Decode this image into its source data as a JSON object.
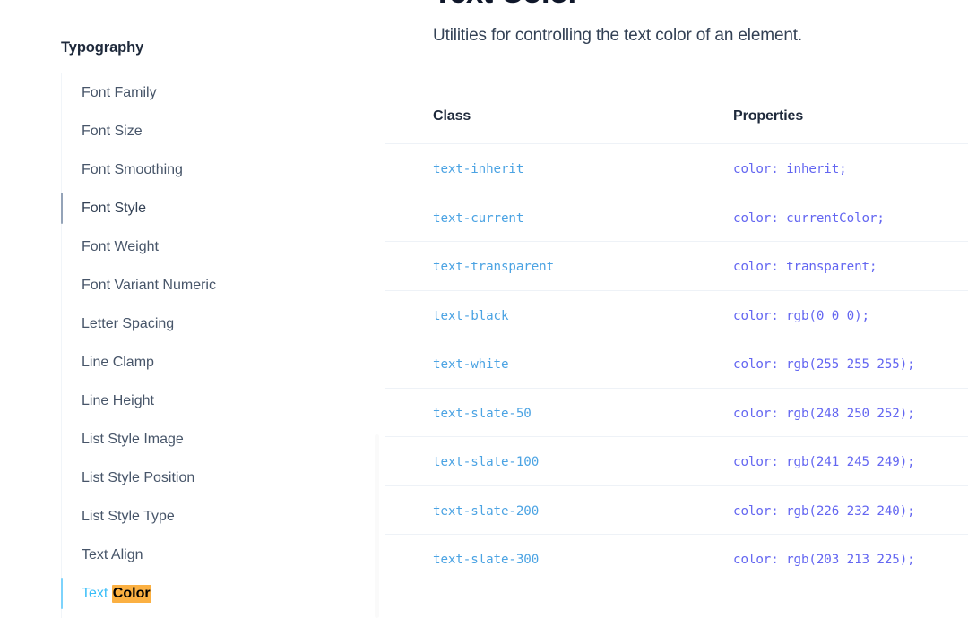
{
  "sidebar": {
    "group_title": "Typography",
    "items": [
      {
        "label": "Font Family",
        "state": "normal"
      },
      {
        "label": "Font Size",
        "state": "normal"
      },
      {
        "label": "Font Smoothing",
        "state": "normal"
      },
      {
        "label": "Font Style",
        "state": "hovered"
      },
      {
        "label": "Font Weight",
        "state": "normal"
      },
      {
        "label": "Font Variant Numeric",
        "state": "normal"
      },
      {
        "label": "Letter Spacing",
        "state": "normal"
      },
      {
        "label": "Line Clamp",
        "state": "normal"
      },
      {
        "label": "Line Height",
        "state": "normal"
      },
      {
        "label": "List Style Image",
        "state": "normal"
      },
      {
        "label": "List Style Position",
        "state": "normal"
      },
      {
        "label": "List Style Type",
        "state": "normal"
      },
      {
        "label": "Text Align",
        "state": "normal"
      },
      {
        "label": "Text Color",
        "state": "active",
        "plain": "Text ",
        "marked": "Color"
      }
    ],
    "active_label": "Text Color",
    "hovered_label": "Font Style"
  },
  "main": {
    "title": "Text Color",
    "subtitle": "Utilities for controlling the text color of an element.",
    "table": {
      "columns": [
        "Class",
        "Properties"
      ],
      "rows": [
        {
          "class": "text-inherit",
          "properties": "color: inherit;"
        },
        {
          "class": "text-current",
          "properties": "color: currentColor;"
        },
        {
          "class": "text-transparent",
          "properties": "color: transparent;"
        },
        {
          "class": "text-black",
          "properties": "color: rgb(0 0 0);"
        },
        {
          "class": "text-white",
          "properties": "color: rgb(255 255 255);"
        },
        {
          "class": "text-slate-50",
          "properties": "color: rgb(248 250 252);"
        },
        {
          "class": "text-slate-100",
          "properties": "color: rgb(241 245 249);"
        },
        {
          "class": "text-slate-200",
          "properties": "color: rgb(226 232 240);"
        },
        {
          "class": "text-slate-300",
          "properties": "color: rgb(203 213 225);"
        }
      ]
    }
  },
  "colors": {
    "class_token": "#4ba3e3",
    "property_token": "#6366f1",
    "active_link": "#38bdf8",
    "highlight_bg": "#fbb042",
    "heading": "#1e293b",
    "body_text": "#475569",
    "divider": "#eef2f7"
  }
}
